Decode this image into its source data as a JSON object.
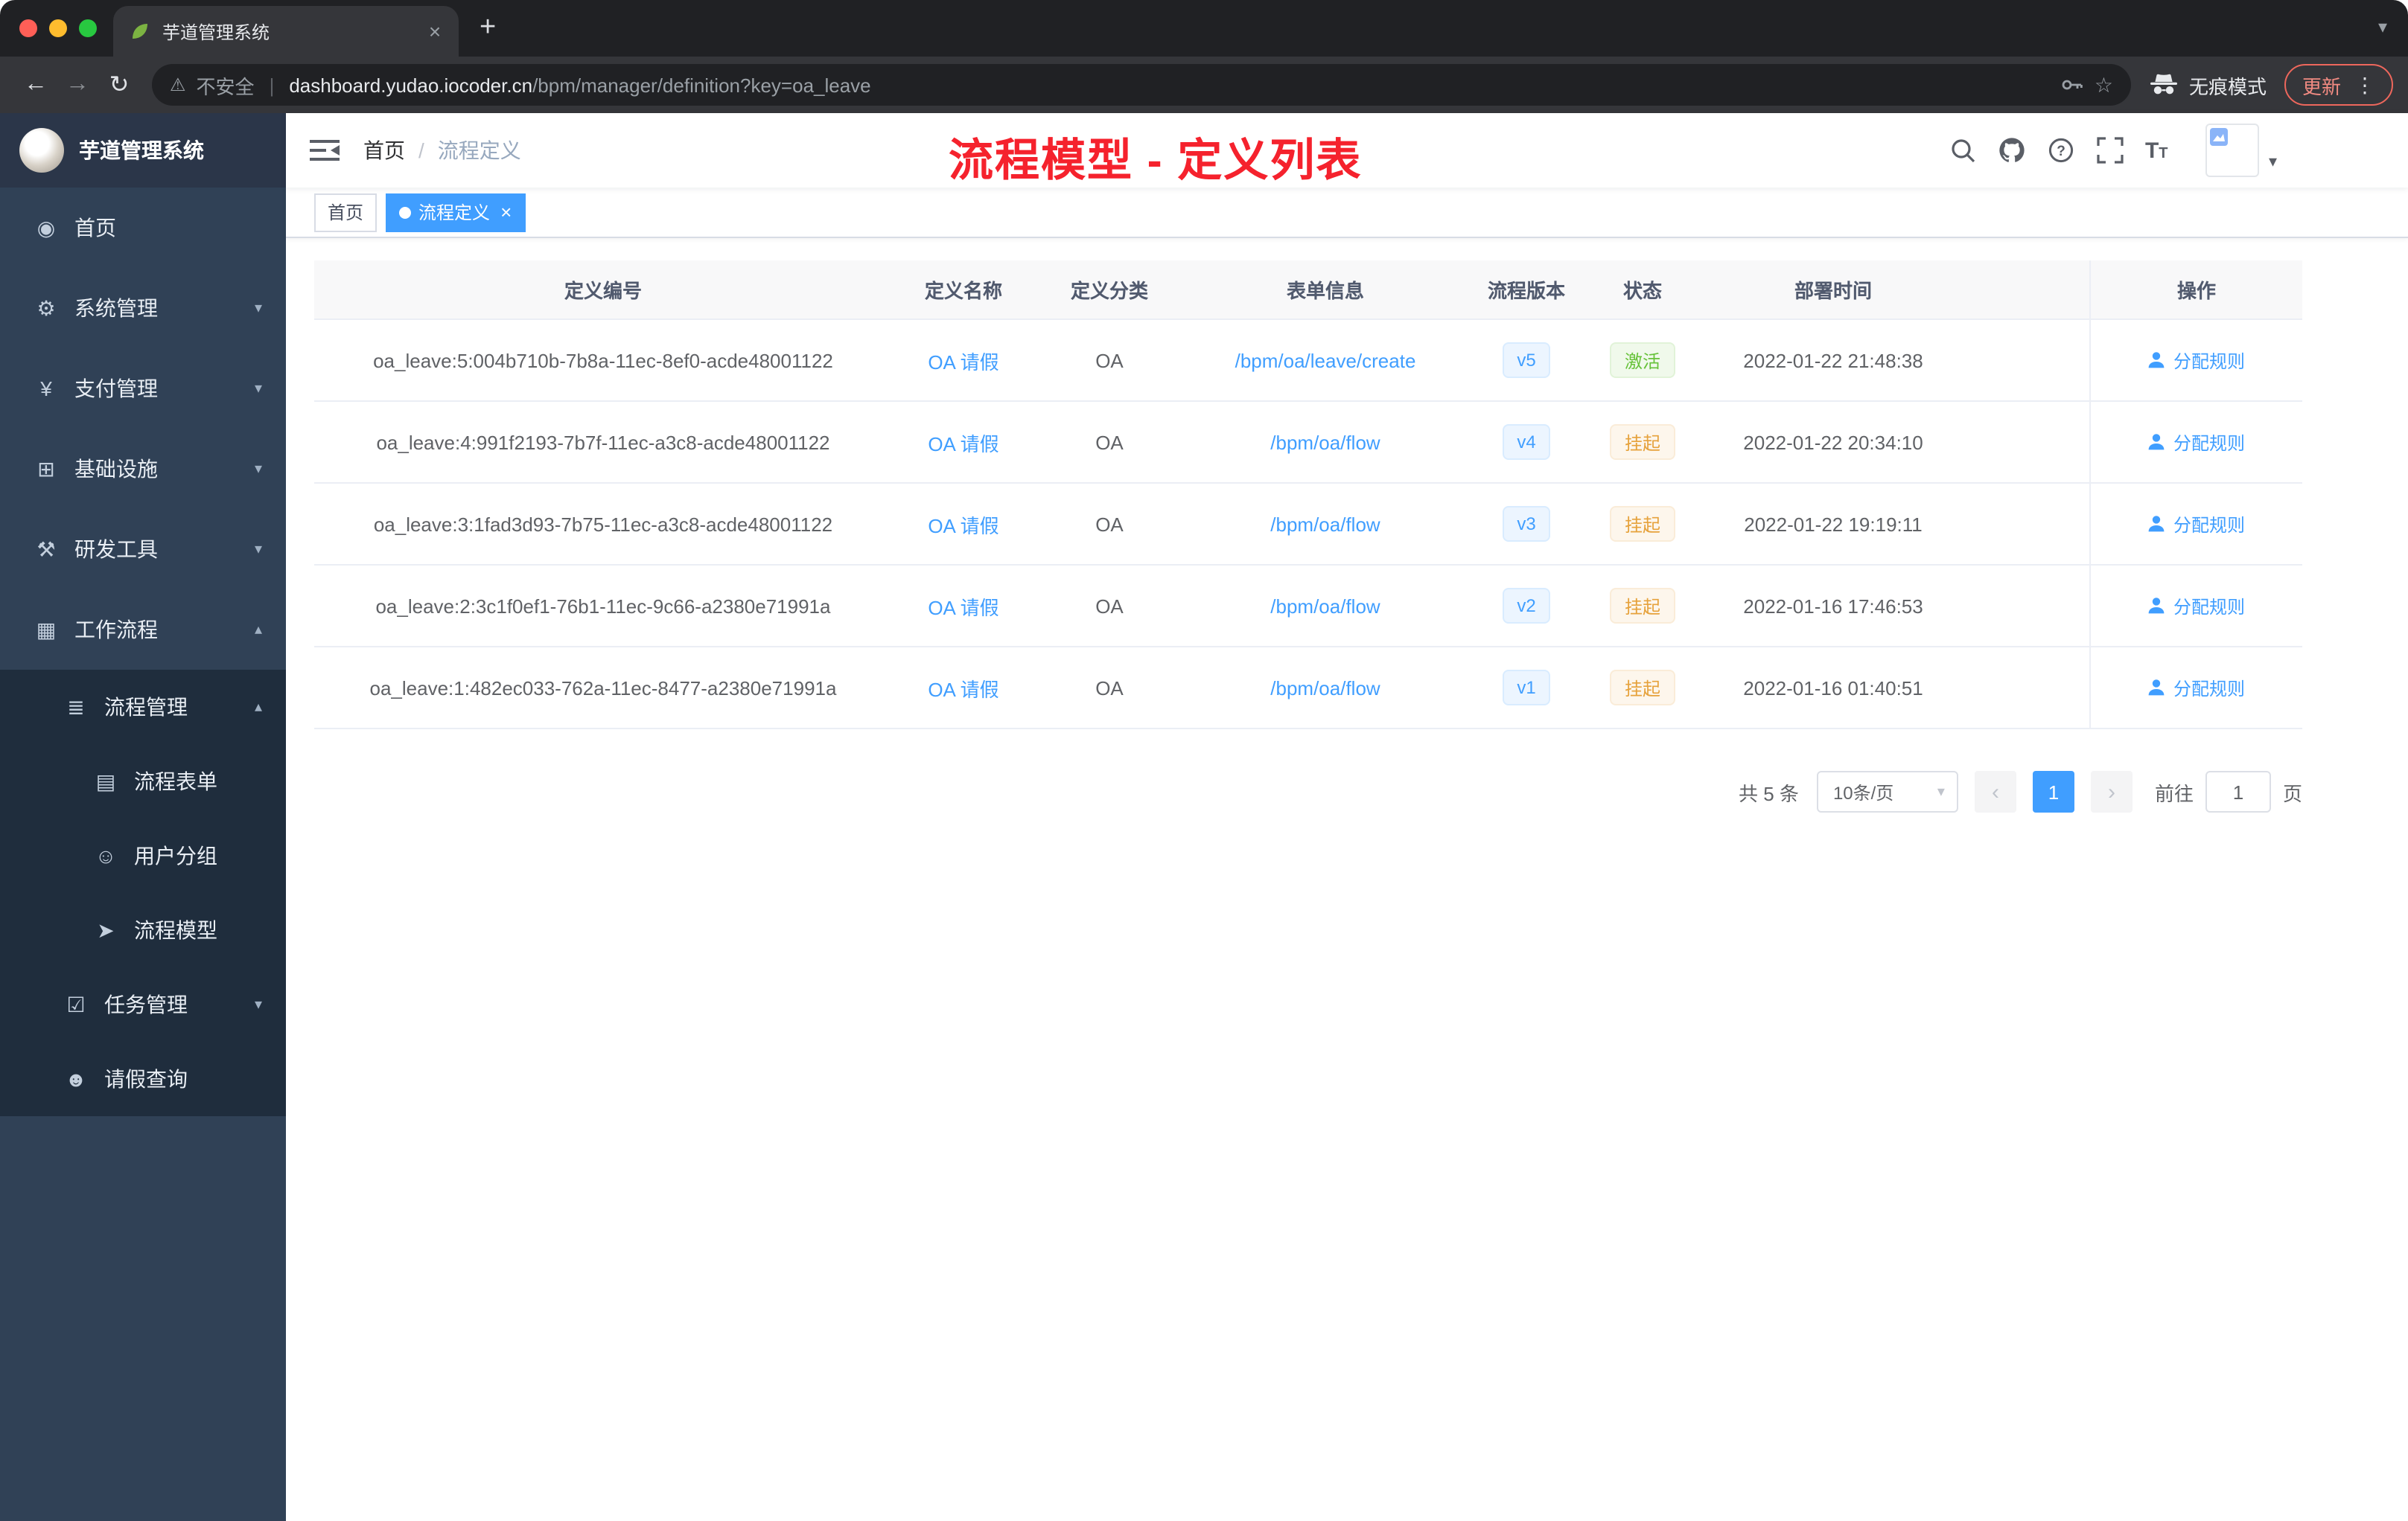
{
  "browser": {
    "tab": {
      "title": "芋道管理系统"
    },
    "address": {
      "security_label": "不安全",
      "host": "dashboard.yudao.iocoder.cn",
      "path": "/bpm/manager/definition?key=oa_leave"
    },
    "incognito_label": "无痕模式",
    "update_label": "更新"
  },
  "sidebar": {
    "logo_title": "芋道管理系统",
    "items": [
      {
        "label": "首页",
        "icon": "dashboard-icon",
        "level": 1
      },
      {
        "label": "系统管理",
        "icon": "gear-icon",
        "level": 1,
        "arrow": "down"
      },
      {
        "label": "支付管理",
        "icon": "payment-icon",
        "level": 1,
        "arrow": "down"
      },
      {
        "label": "基础设施",
        "icon": "infrastructure-icon",
        "level": 1,
        "arrow": "down"
      },
      {
        "label": "研发工具",
        "icon": "devtools-icon",
        "level": 1,
        "arrow": "down"
      },
      {
        "label": "工作流程",
        "icon": "workflow-icon",
        "level": 1,
        "arrow": "up"
      },
      {
        "label": "流程管理",
        "icon": "process-manage-icon",
        "level": 2,
        "arrow": "up"
      },
      {
        "label": "流程表单",
        "icon": "form-icon",
        "level": 3
      },
      {
        "label": "用户分组",
        "icon": "user-group-icon",
        "level": 3
      },
      {
        "label": "流程模型",
        "icon": "model-icon",
        "level": 3
      },
      {
        "label": "任务管理",
        "icon": "task-icon",
        "level": 2,
        "arrow": "down"
      },
      {
        "label": "请假查询",
        "icon": "leave-query-icon",
        "level": 2
      }
    ]
  },
  "navbar": {
    "breadcrumb": {
      "home": "首页",
      "separator": "/",
      "current": "流程定义"
    },
    "annotation": "流程模型 - 定义列表"
  },
  "tags": {
    "items": [
      {
        "label": "首页",
        "active": false
      },
      {
        "label": "流程定义",
        "active": true
      }
    ]
  },
  "table": {
    "columns": {
      "id": "定义编号",
      "name": "定义名称",
      "category": "定义分类",
      "form": "表单信息",
      "version": "流程版本",
      "status": "状态",
      "deploy_time": "部署时间",
      "action": "操作"
    },
    "rows": [
      {
        "id": "oa_leave:5:004b710b-7b8a-11ec-8ef0-acde48001122",
        "name": "OA 请假",
        "category": "OA",
        "form": "/bpm/oa/leave/create",
        "version": "v5",
        "status": "激活",
        "status_type": "success",
        "deploy_time": "2022-01-22 21:48:38",
        "action": "分配规则"
      },
      {
        "id": "oa_leave:4:991f2193-7b7f-11ec-a3c8-acde48001122",
        "name": "OA 请假",
        "category": "OA",
        "form": "/bpm/oa/flow",
        "version": "v4",
        "status": "挂起",
        "status_type": "warning",
        "deploy_time": "2022-01-22 20:34:10",
        "action": "分配规则"
      },
      {
        "id": "oa_leave:3:1fad3d93-7b75-11ec-a3c8-acde48001122",
        "name": "OA 请假",
        "category": "OA",
        "form": "/bpm/oa/flow",
        "version": "v3",
        "status": "挂起",
        "status_type": "warning",
        "deploy_time": "2022-01-22 19:19:11",
        "action": "分配规则"
      },
      {
        "id": "oa_leave:2:3c1f0ef1-76b1-11ec-9c66-a2380e71991a",
        "name": "OA 请假",
        "category": "OA",
        "form": "/bpm/oa/flow",
        "version": "v2",
        "status": "挂起",
        "status_type": "warning",
        "deploy_time": "2022-01-16 17:46:53",
        "action": "分配规则"
      },
      {
        "id": "oa_leave:1:482ec033-762a-11ec-8477-a2380e71991a",
        "name": "OA 请假",
        "category": "OA",
        "form": "/bpm/oa/flow",
        "version": "v1",
        "status": "挂起",
        "status_type": "warning",
        "deploy_time": "2022-01-16 01:40:51",
        "action": "分配规则"
      }
    ]
  },
  "pagination": {
    "total": "共 5 条",
    "size_label": "10条/页",
    "page": "1",
    "goto_label": "前往",
    "goto_value": "1",
    "unit_label": "页"
  },
  "colors": {
    "accent": "#409eff",
    "annotation_red": "#f5222d",
    "success_green": "#67c23a",
    "warning_orange": "#e6a23c",
    "sidebar_bg": "#304156",
    "submenu_bg": "#1f2d3d"
  }
}
